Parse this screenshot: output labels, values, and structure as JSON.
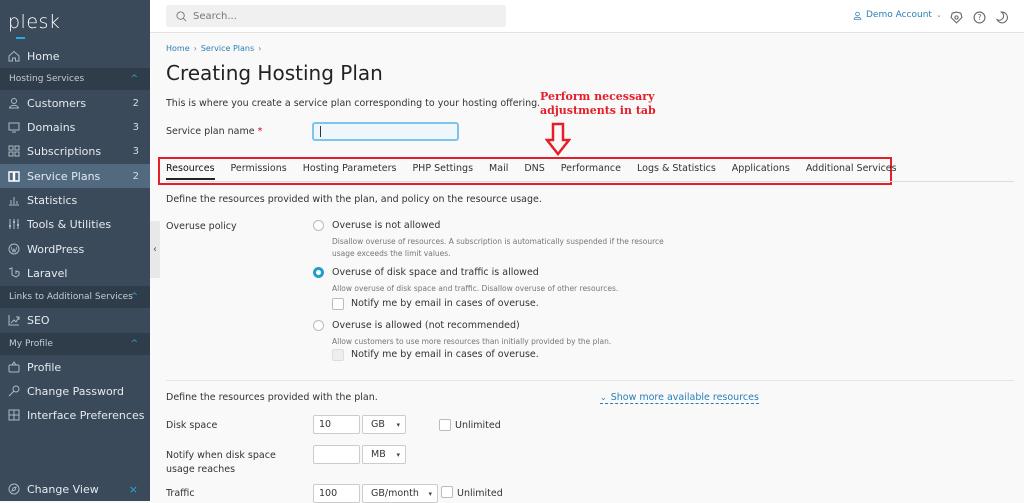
{
  "sidebar": {
    "logo": "plesk",
    "home": "Home",
    "sections": [
      {
        "label": "Hosting Services"
      },
      {
        "label": "Links to Additional Services"
      },
      {
        "label": "My Profile"
      }
    ],
    "hosting_items": [
      {
        "label": "Customers",
        "count": "2",
        "icon": "user-icon"
      },
      {
        "label": "Domains",
        "count": "3",
        "icon": "monitor-icon"
      },
      {
        "label": "Subscriptions",
        "count": "3",
        "icon": "grid-icon"
      },
      {
        "label": "Service Plans",
        "count": "2",
        "icon": "book-icon",
        "active": true
      },
      {
        "label": "Statistics",
        "icon": "bar-chart-icon"
      },
      {
        "label": "Tools & Utilities",
        "icon": "sliders-icon"
      },
      {
        "label": "WordPress",
        "icon": "wordpress-icon"
      },
      {
        "label": "Laravel",
        "icon": "laravel-icon"
      }
    ],
    "additional_items": [
      {
        "label": "SEO",
        "icon": "seo-chart-icon"
      }
    ],
    "profile_items": [
      {
        "label": "Profile",
        "icon": "profile-icon"
      },
      {
        "label": "Change Password",
        "icon": "key-icon"
      },
      {
        "label": "Interface Preferences",
        "icon": "preferences-icon"
      }
    ],
    "change_view": "Change View"
  },
  "topbar": {
    "search_placeholder": "Search...",
    "account": "Demo Account"
  },
  "breadcrumb": [
    "Home",
    "Service Plans"
  ],
  "page_title": "Creating Hosting Plan",
  "intro": "This is where you create a service plan corresponding to your hosting offering.",
  "plan_name_label": "Service plan name",
  "plan_name_required": "*",
  "plan_name_value": "",
  "annotation": {
    "line1": "Perform necessary",
    "line2": "adjustments in tab",
    "color": "#e3202a"
  },
  "tabs": [
    {
      "label": "Resources",
      "active": true
    },
    {
      "label": "Permissions"
    },
    {
      "label": "Hosting Parameters"
    },
    {
      "label": "PHP Settings"
    },
    {
      "label": "Mail"
    },
    {
      "label": "DNS"
    },
    {
      "label": "Performance"
    },
    {
      "label": "Logs & Statistics"
    },
    {
      "label": "Applications"
    },
    {
      "label": "Additional Services"
    }
  ],
  "resources": {
    "description": "Define the resources provided with the plan, and policy on the resource usage.",
    "overuse_label": "Overuse policy",
    "options": [
      {
        "label": "Overuse is not allowed",
        "hint": "Disallow overuse of resources. A subscription is automatically suspended if the resource usage exceeds the limit values.",
        "selected": false
      },
      {
        "label": "Overuse of disk space and traffic is allowed",
        "hint": "Allow overuse of disk space and traffic. Disallow overuse of other resources.",
        "selected": true,
        "notify": "Notify me by email in cases of overuse."
      },
      {
        "label": "Overuse is allowed (not recommended)",
        "hint": "Allow customers to use more resources than initially provided by the plan.",
        "selected": false,
        "notify": "Notify me by email in cases of overuse."
      }
    ],
    "plan_resources_desc": "Define the resources provided with the plan.",
    "show_more": "Show more available resources",
    "disk_space": {
      "label": "Disk space",
      "value": "10",
      "unit": "GB",
      "unlimited": "Unlimited"
    },
    "notify_disk": {
      "label": "Notify when disk space usage reaches",
      "value": "",
      "unit": "MB"
    },
    "traffic": {
      "label": "Traffic",
      "value": "100",
      "unit": "GB/month",
      "unlimited": "Unlimited"
    }
  },
  "colors": {
    "sidebar": "#3a4a5a",
    "accent": "#28aade",
    "link": "#2a7fb8"
  }
}
